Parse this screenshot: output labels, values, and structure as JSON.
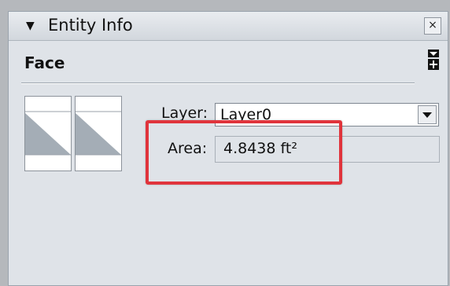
{
  "window": {
    "title": "Entity Info",
    "close_glyph": "×"
  },
  "panel": {
    "entity_type": "Face",
    "toggle_glyph": "+"
  },
  "materials": {
    "front_label": "front-material-swatch",
    "back_label": "back-material-swatch"
  },
  "fields": {
    "layer_label": "Layer:",
    "layer_value": "Layer0",
    "area_label": "Area:",
    "area_value": "4.8438 ft²"
  },
  "colors": {
    "highlight": "#e0343c",
    "swatch_gray": "#a4adb6"
  }
}
